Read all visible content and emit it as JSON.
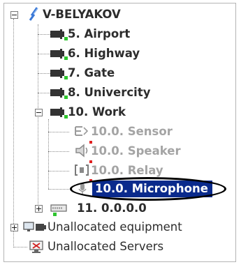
{
  "tree": {
    "root": {
      "label": "V-BELYAKOV"
    },
    "cameras": [
      {
        "label": "5. Airport"
      },
      {
        "label": "6. Highway"
      },
      {
        "label": "7. Gate"
      },
      {
        "label": "8. Univercity"
      },
      {
        "label": "10. Work"
      }
    ],
    "children_of_work": [
      {
        "label": "10.0. Sensor",
        "icon": "sensor-icon"
      },
      {
        "label": "10.0. Speaker",
        "icon": "speaker-icon"
      },
      {
        "label": "10.0. Relay",
        "icon": "relay-icon"
      },
      {
        "label": "10.0. Microphone",
        "icon": "microphone-icon"
      }
    ],
    "ip_device": {
      "label": "11. 0.0.0.0"
    },
    "unallocated_equipment": {
      "label": "Unallocated equipment"
    },
    "unallocated_servers": {
      "label": "Unallocated Servers"
    }
  },
  "colors": {
    "selection_bg": "#0a2a8c",
    "disabled_text": "#a4a4a4",
    "status_green": "#2ec52e",
    "status_red": "#e02020"
  }
}
